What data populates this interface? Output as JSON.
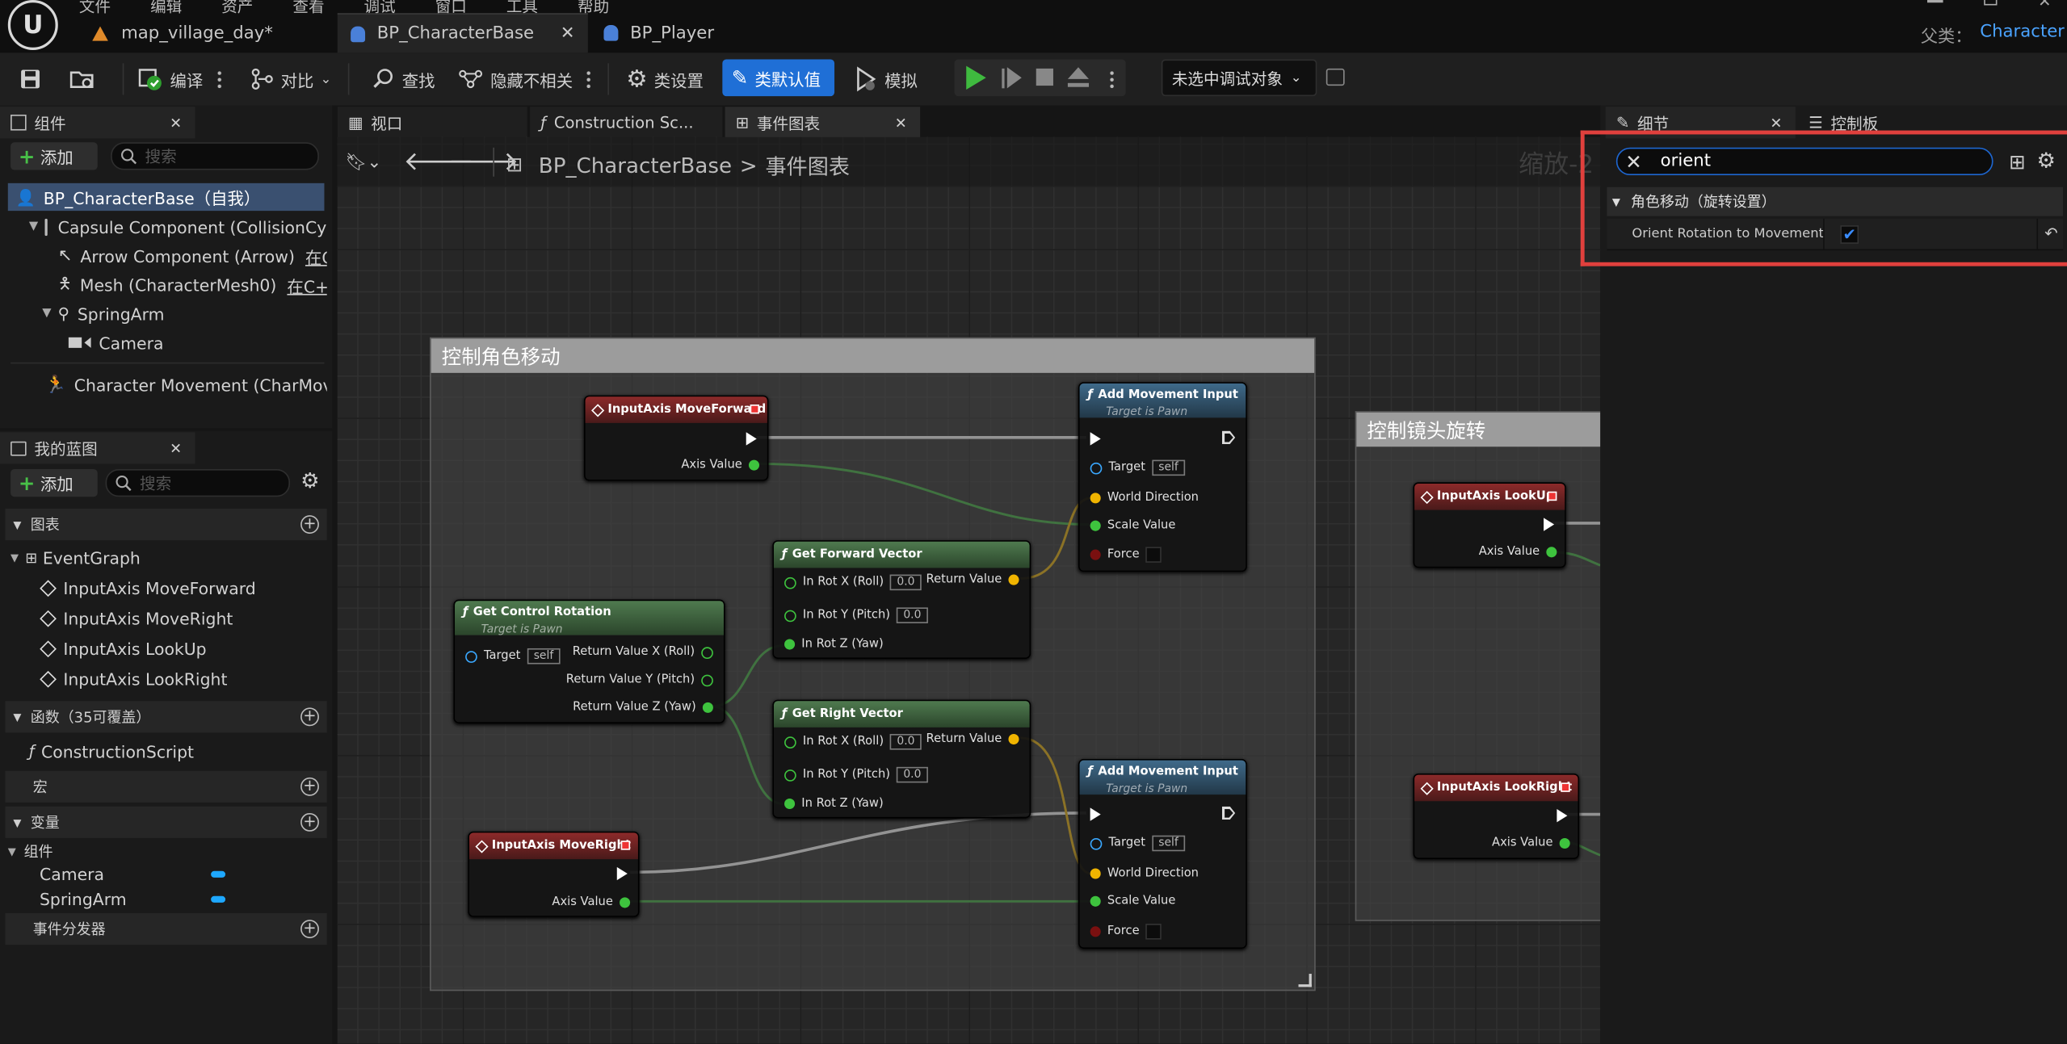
{
  "menu": {
    "file": "文件",
    "edit": "编辑",
    "asset": "资产",
    "view": "查看",
    "debug": "调试",
    "window": "窗口",
    "tools": "工具",
    "help": "帮助"
  },
  "tabs": [
    {
      "label": "map_village_day*"
    },
    {
      "label": "BP_CharacterBase"
    },
    {
      "label": "BP_Player"
    }
  ],
  "parent_class": {
    "label": "父类：",
    "value": "Character"
  },
  "toolbar": {
    "compile": "编译",
    "diff": "对比",
    "find": "查找",
    "hide_unrelated": "隐藏不相关",
    "class_settings": "类设置",
    "class_defaults": "类默认值",
    "simulate": "模拟",
    "debug_target": "未选中调试对象"
  },
  "components_panel": {
    "title": "组件",
    "add": "添加",
    "search_placeholder": "搜索",
    "items": [
      {
        "label": "BP_CharacterBase（自我）"
      },
      {
        "label": "Capsule Component (CollisionCylin"
      },
      {
        "label": "Arrow Component (Arrow)",
        "link": "在C++"
      },
      {
        "label": "Mesh (CharacterMesh0)",
        "link": "在C++中"
      },
      {
        "label": "SpringArm"
      },
      {
        "label": "Camera"
      },
      {
        "label": "Character Movement (CharMoveCo"
      }
    ]
  },
  "my_blueprint": {
    "title": "我的蓝图",
    "add": "添加",
    "search_placeholder": "搜索",
    "graphs": {
      "label": "图表",
      "event_graph": "EventGraph",
      "events": [
        "InputAxis MoveForward",
        "InputAxis MoveRight",
        "InputAxis LookUp",
        "InputAxis LookRight"
      ]
    },
    "functions": {
      "label": "函数（35可覆盖）",
      "items": [
        "ConstructionScript"
      ]
    },
    "macros": "宏",
    "variables": {
      "label": "变量",
      "group": "组件",
      "items": [
        "Camera",
        "SpringArm"
      ]
    },
    "dispatchers": "事件分发器"
  },
  "editor_tabs": {
    "viewport": "视口",
    "construction": "Construction Sc...",
    "event_graph": "事件图表"
  },
  "breadcrumb": {
    "root": "BP_CharacterBase",
    "sep": ">",
    "current": "事件图表",
    "zoom": "缩放-2"
  },
  "graph": {
    "comment1": "控制角色移动",
    "comment2": "控制镜头旋转",
    "nodes": {
      "move_forward": {
        "title": "InputAxis MoveForward",
        "axis": "Axis Value"
      },
      "move_right": {
        "title": "InputAxis MoveRight",
        "axis": "Axis Value"
      },
      "look_up": {
        "title": "InputAxis LookUp",
        "axis": "Axis Value"
      },
      "look_right": {
        "title": "InputAxis LookRight",
        "axis": "Axis Value"
      },
      "control_rot": {
        "title": "Get Control Rotation",
        "sub": "Target is Pawn",
        "target": "Target",
        "self": "self",
        "rx": "Return Value X (Roll)",
        "ry": "Return Value Y (Pitch)",
        "rz": "Return Value Z (Yaw)"
      },
      "fwd_vec": {
        "title": "Get Forward Vector",
        "rx": "In Rot X (Roll)",
        "ry": "In Rot Y (Pitch)",
        "rz": "In Rot Z (Yaw)",
        "v": "0.0",
        "ret": "Return Value"
      },
      "right_vec": {
        "title": "Get Right Vector",
        "rx": "In Rot X (Roll)",
        "ry": "In Rot Y (Pitch)",
        "rz": "In Rot Z (Yaw)",
        "v": "0.0",
        "ret": "Return Value"
      },
      "add_move1": {
        "title": "Add Movement Input",
        "sub": "Target is Pawn",
        "target": "Target",
        "self": "self",
        "dir": "World Direction",
        "scale": "Scale Value",
        "force": "Force"
      },
      "add_move2": {
        "title": "Add Movement Input",
        "sub": "Target is Pawn",
        "target": "Target",
        "self": "self",
        "dir": "World Direction",
        "scale": "Scale Value",
        "force": "Force"
      }
    }
  },
  "details": {
    "tab": "细节",
    "tab2": "控制板",
    "search_value": "orient",
    "category": "角色移动（旋转设置）",
    "property": "Orient Rotation to Movement",
    "checked": true
  },
  "colors": {
    "accent": "#1f6fd6",
    "highlight": "#e0403d",
    "exec": "#ffffff",
    "float": "#3ec33e",
    "vector": "#f0b400",
    "object": "#3aa8ff"
  }
}
